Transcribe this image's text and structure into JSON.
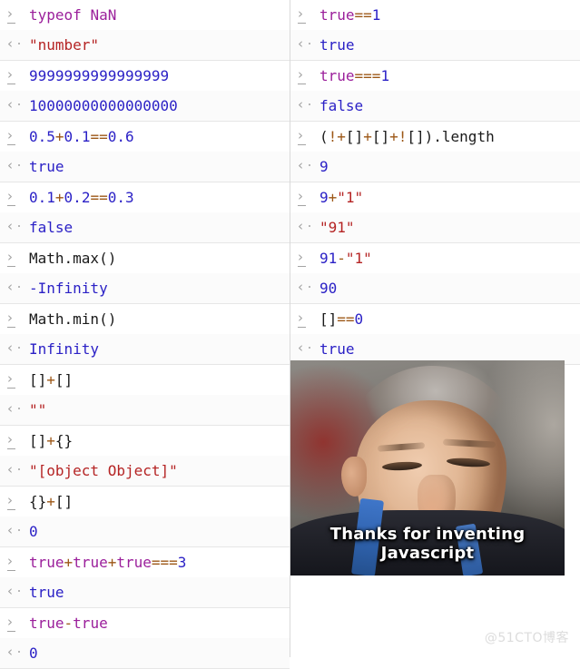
{
  "markers": {
    "input": "›",
    "output": "‹"
  },
  "watermark": "@51CTO博客",
  "meme": {
    "caption": "Thanks for inventing Javascript",
    "alt": "Portrait photo of a smiling middle-aged man wearing a dark suit and blue conference lanyard"
  },
  "left_column": [
    {
      "input": [
        {
          "t": "typeof ",
          "c": "kw"
        },
        {
          "t": "NaN",
          "c": "kw"
        }
      ],
      "output": [
        {
          "t": "\"number\"",
          "c": "outs"
        }
      ],
      "input_text": "typeof NaN",
      "output_text": "\"number\""
    },
    {
      "input": [
        {
          "t": "9999999999999999",
          "c": "num"
        }
      ],
      "output": [
        {
          "t": "10000000000000000",
          "c": "out"
        }
      ],
      "input_text": "9999999999999999",
      "output_text": "10000000000000000"
    },
    {
      "input": [
        {
          "t": "0.5",
          "c": "num"
        },
        {
          "t": "+",
          "c": "op"
        },
        {
          "t": "0.1",
          "c": "num"
        },
        {
          "t": "==",
          "c": "op"
        },
        {
          "t": "0.6",
          "c": "num"
        }
      ],
      "output": [
        {
          "t": "true",
          "c": "out"
        }
      ],
      "input_text": "0.5+0.1==0.6",
      "output_text": "true"
    },
    {
      "input": [
        {
          "t": "0.1",
          "c": "num"
        },
        {
          "t": "+",
          "c": "op"
        },
        {
          "t": "0.2",
          "c": "num"
        },
        {
          "t": "==",
          "c": "op"
        },
        {
          "t": "0.3",
          "c": "num"
        }
      ],
      "output": [
        {
          "t": "false",
          "c": "out"
        }
      ],
      "input_text": "0.1+0.2==0.3",
      "output_text": "false"
    },
    {
      "input": [
        {
          "t": "Math.max()",
          "c": "id"
        }
      ],
      "output": [
        {
          "t": "-Infinity",
          "c": "out"
        }
      ],
      "input_text": "Math.max()",
      "output_text": "-Infinity"
    },
    {
      "input": [
        {
          "t": "Math.min()",
          "c": "id"
        }
      ],
      "output": [
        {
          "t": "Infinity",
          "c": "out"
        }
      ],
      "input_text": "Math.min()",
      "output_text": "Infinity"
    },
    {
      "input": [
        {
          "t": "[]",
          "c": "id"
        },
        {
          "t": "+",
          "c": "op"
        },
        {
          "t": "[]",
          "c": "id"
        }
      ],
      "output": [
        {
          "t": "\"\"",
          "c": "outs"
        }
      ],
      "input_text": "[]+[]",
      "output_text": "\"\""
    },
    {
      "input": [
        {
          "t": "[]",
          "c": "id"
        },
        {
          "t": "+",
          "c": "op"
        },
        {
          "t": "{}",
          "c": "id"
        }
      ],
      "output": [
        {
          "t": "\"[object Object]\"",
          "c": "outs"
        }
      ],
      "input_text": "[]+{}",
      "output_text": "\"[object Object]\""
    },
    {
      "input": [
        {
          "t": "{}",
          "c": "id"
        },
        {
          "t": "+",
          "c": "op"
        },
        {
          "t": "[]",
          "c": "id"
        }
      ],
      "output": [
        {
          "t": "0",
          "c": "out"
        }
      ],
      "input_text": "{}+[]",
      "output_text": "0"
    },
    {
      "input": [
        {
          "t": "true",
          "c": "kw"
        },
        {
          "t": "+",
          "c": "op"
        },
        {
          "t": "true",
          "c": "kw"
        },
        {
          "t": "+",
          "c": "op"
        },
        {
          "t": "true",
          "c": "kw"
        },
        {
          "t": "===",
          "c": "op"
        },
        {
          "t": "3",
          "c": "num"
        }
      ],
      "output": [
        {
          "t": "true",
          "c": "out"
        }
      ],
      "input_text": "true+true+true===3",
      "output_text": "true"
    },
    {
      "input": [
        {
          "t": "true",
          "c": "kw"
        },
        {
          "t": "-",
          "c": "op"
        },
        {
          "t": "true",
          "c": "kw"
        }
      ],
      "output": [
        {
          "t": "0",
          "c": "out"
        }
      ],
      "input_text": "true-true",
      "output_text": "0"
    }
  ],
  "right_column": [
    {
      "input": [
        {
          "t": "true",
          "c": "kw"
        },
        {
          "t": "==",
          "c": "op"
        },
        {
          "t": "1",
          "c": "num"
        }
      ],
      "output": [
        {
          "t": "true",
          "c": "out"
        }
      ],
      "input_text": "true==1",
      "output_text": "true"
    },
    {
      "input": [
        {
          "t": "true",
          "c": "kw"
        },
        {
          "t": "===",
          "c": "op"
        },
        {
          "t": "1",
          "c": "num"
        }
      ],
      "output": [
        {
          "t": "false",
          "c": "out"
        }
      ],
      "input_text": "true===1",
      "output_text": "false"
    },
    {
      "input": [
        {
          "t": "(",
          "c": "id"
        },
        {
          "t": "!",
          "c": "op"
        },
        {
          "t": "+",
          "c": "op"
        },
        {
          "t": "[]",
          "c": "id"
        },
        {
          "t": "+",
          "c": "op"
        },
        {
          "t": "[]",
          "c": "id"
        },
        {
          "t": "+",
          "c": "op"
        },
        {
          "t": "!",
          "c": "op"
        },
        {
          "t": "[]).length",
          "c": "id"
        }
      ],
      "output": [
        {
          "t": "9",
          "c": "out"
        }
      ],
      "input_text": "(!+[]+[]+![]).length",
      "output_text": "9"
    },
    {
      "input": [
        {
          "t": "9",
          "c": "num"
        },
        {
          "t": "+",
          "c": "op"
        },
        {
          "t": "\"1\"",
          "c": "str"
        }
      ],
      "output": [
        {
          "t": "\"91\"",
          "c": "outs"
        }
      ],
      "input_text": "9+\"1\"",
      "output_text": "\"91\""
    },
    {
      "input": [
        {
          "t": "91",
          "c": "num"
        },
        {
          "t": "-",
          "c": "op"
        },
        {
          "t": "\"1\"",
          "c": "str"
        }
      ],
      "output": [
        {
          "t": "90",
          "c": "out"
        }
      ],
      "input_text": "91-\"1\"",
      "output_text": "90"
    },
    {
      "input": [
        {
          "t": "[]",
          "c": "id"
        },
        {
          "t": "==",
          "c": "op"
        },
        {
          "t": "0",
          "c": "num"
        }
      ],
      "output": [
        {
          "t": "true",
          "c": "out"
        }
      ],
      "input_text": "[]==0",
      "output_text": "true"
    }
  ],
  "colors": {
    "keyword": "#9b1f9b",
    "number": "#2b21c6",
    "operator": "#9c5716",
    "string": "#b52424",
    "identifier": "#1a1a1a",
    "marker": "#a3a3a3",
    "separator": "#e6e6e6",
    "background": "#ffffff"
  }
}
